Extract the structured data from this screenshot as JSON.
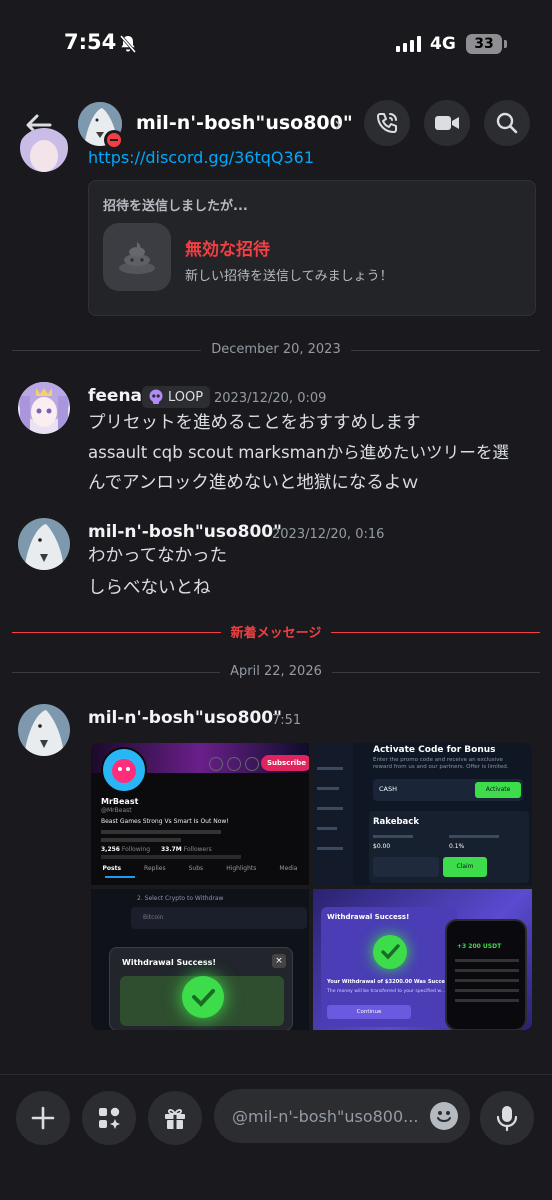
{
  "status_bar": {
    "time": "7:54",
    "network": "4G",
    "battery": "33"
  },
  "header": {
    "channel_name": "mil-n'-bosh\"uso800\""
  },
  "messages": {
    "invite": {
      "link_text": "https://discord.gg/36tqQ361",
      "heading": "招待を送信しましたが...",
      "title": "無効な招待",
      "subtitle": "新しい招待を送信してみましょう！"
    },
    "date_1": "December 20, 2023",
    "msg_feena": {
      "author": "feena",
      "badge": "LOOP",
      "timestamp": "2023/12/20, 0:09",
      "lines": [
        "プリセットを進めることをおすすめします",
        "assault cqb scout marksmanから進めたいツリーを選",
        "んでアンロック進めないと地獄になるよｗ"
      ]
    },
    "msg_uso_1": {
      "author": "mil-n'-bosh\"uso800\"",
      "timestamp": "2023/12/20, 0:16",
      "lines": [
        "わかってなかった",
        "しらべないとね"
      ]
    },
    "new_messages_label": "新着メッセージ",
    "date_2": "April 22, 2026",
    "msg_uso_2": {
      "author": "mil-n'-bosh\"uso800\"",
      "timestamp": "7:51",
      "images": [
        {
          "name": "MrBeast",
          "handle": "@MrBeast",
          "bio": "Beast Games Strong Vs Smart Is Out Now!",
          "following": "3,256",
          "following_label": "Following",
          "followers": "33.7M",
          "followers_label": "Followers",
          "subscribe": "Subscribe",
          "tabs": [
            "Posts",
            "Replies",
            "Subs",
            "Highlights",
            "Media"
          ]
        },
        {
          "activate_title": "Activate Code for Bonus",
          "promo_desc": "Enter the promo code and receive an exclusive reward from us and our partners. Offer is limited.",
          "code_value": "CASH",
          "activate_button": "Activate",
          "rakeback_title": "Rakeback",
          "rakeback_amount": "$0.00",
          "rakeback_percent": "0.1%",
          "claim_button": "Claim"
        },
        {
          "step_label": "2. Select Crypto to Withdraw",
          "coin": "Bitcoin",
          "modal_title": "Withdrawal Success!"
        },
        {
          "modal_title": "Withdrawal Success!",
          "amount_text": "Your Withdrawal of $3200.00 Was Success!",
          "desc": "The money will be transferred to your specified w...",
          "continue_button": "Continue",
          "phone_amount": "+3 200 USDT"
        }
      ]
    }
  },
  "composer": {
    "placeholder": "@mil-n'-bosh\"uso800..."
  },
  "colors": {
    "background": "#1a1a1e",
    "accent_red": "#f23f43",
    "link_blue": "#00a8fc",
    "success_green": "#3ddc4a"
  }
}
